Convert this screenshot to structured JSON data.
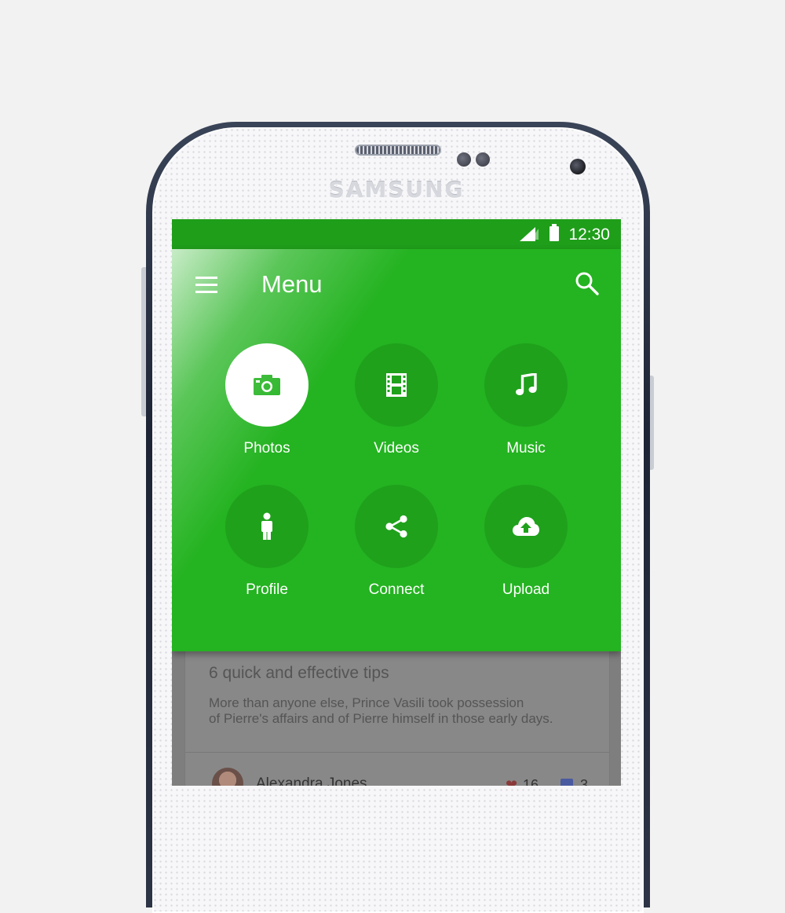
{
  "device": {
    "brand": "SAMSUNG"
  },
  "status_bar": {
    "time": "12:30",
    "background": "#1f9e1a"
  },
  "menu": {
    "title": "Menu",
    "accent": "#24b321",
    "items": [
      {
        "label": "Photos",
        "icon": "camera-icon",
        "active": true
      },
      {
        "label": "Videos",
        "icon": "film-icon",
        "active": false
      },
      {
        "label": "Music",
        "icon": "music-note-icon",
        "active": false
      },
      {
        "label": "Profile",
        "icon": "person-icon",
        "active": false
      },
      {
        "label": "Connect",
        "icon": "share-icon",
        "active": false
      },
      {
        "label": "Upload",
        "icon": "cloud-upload-icon",
        "active": false
      }
    ]
  },
  "card": {
    "subtitle": "6 quick and effective tips",
    "text_line1": "More than anyone else, Prince Vasili took possession",
    "text_line2": "of Pierre's affairs and of Pierre himself in those early days.",
    "author": "Alexandra Jones",
    "likes": "16",
    "comments": "3"
  }
}
